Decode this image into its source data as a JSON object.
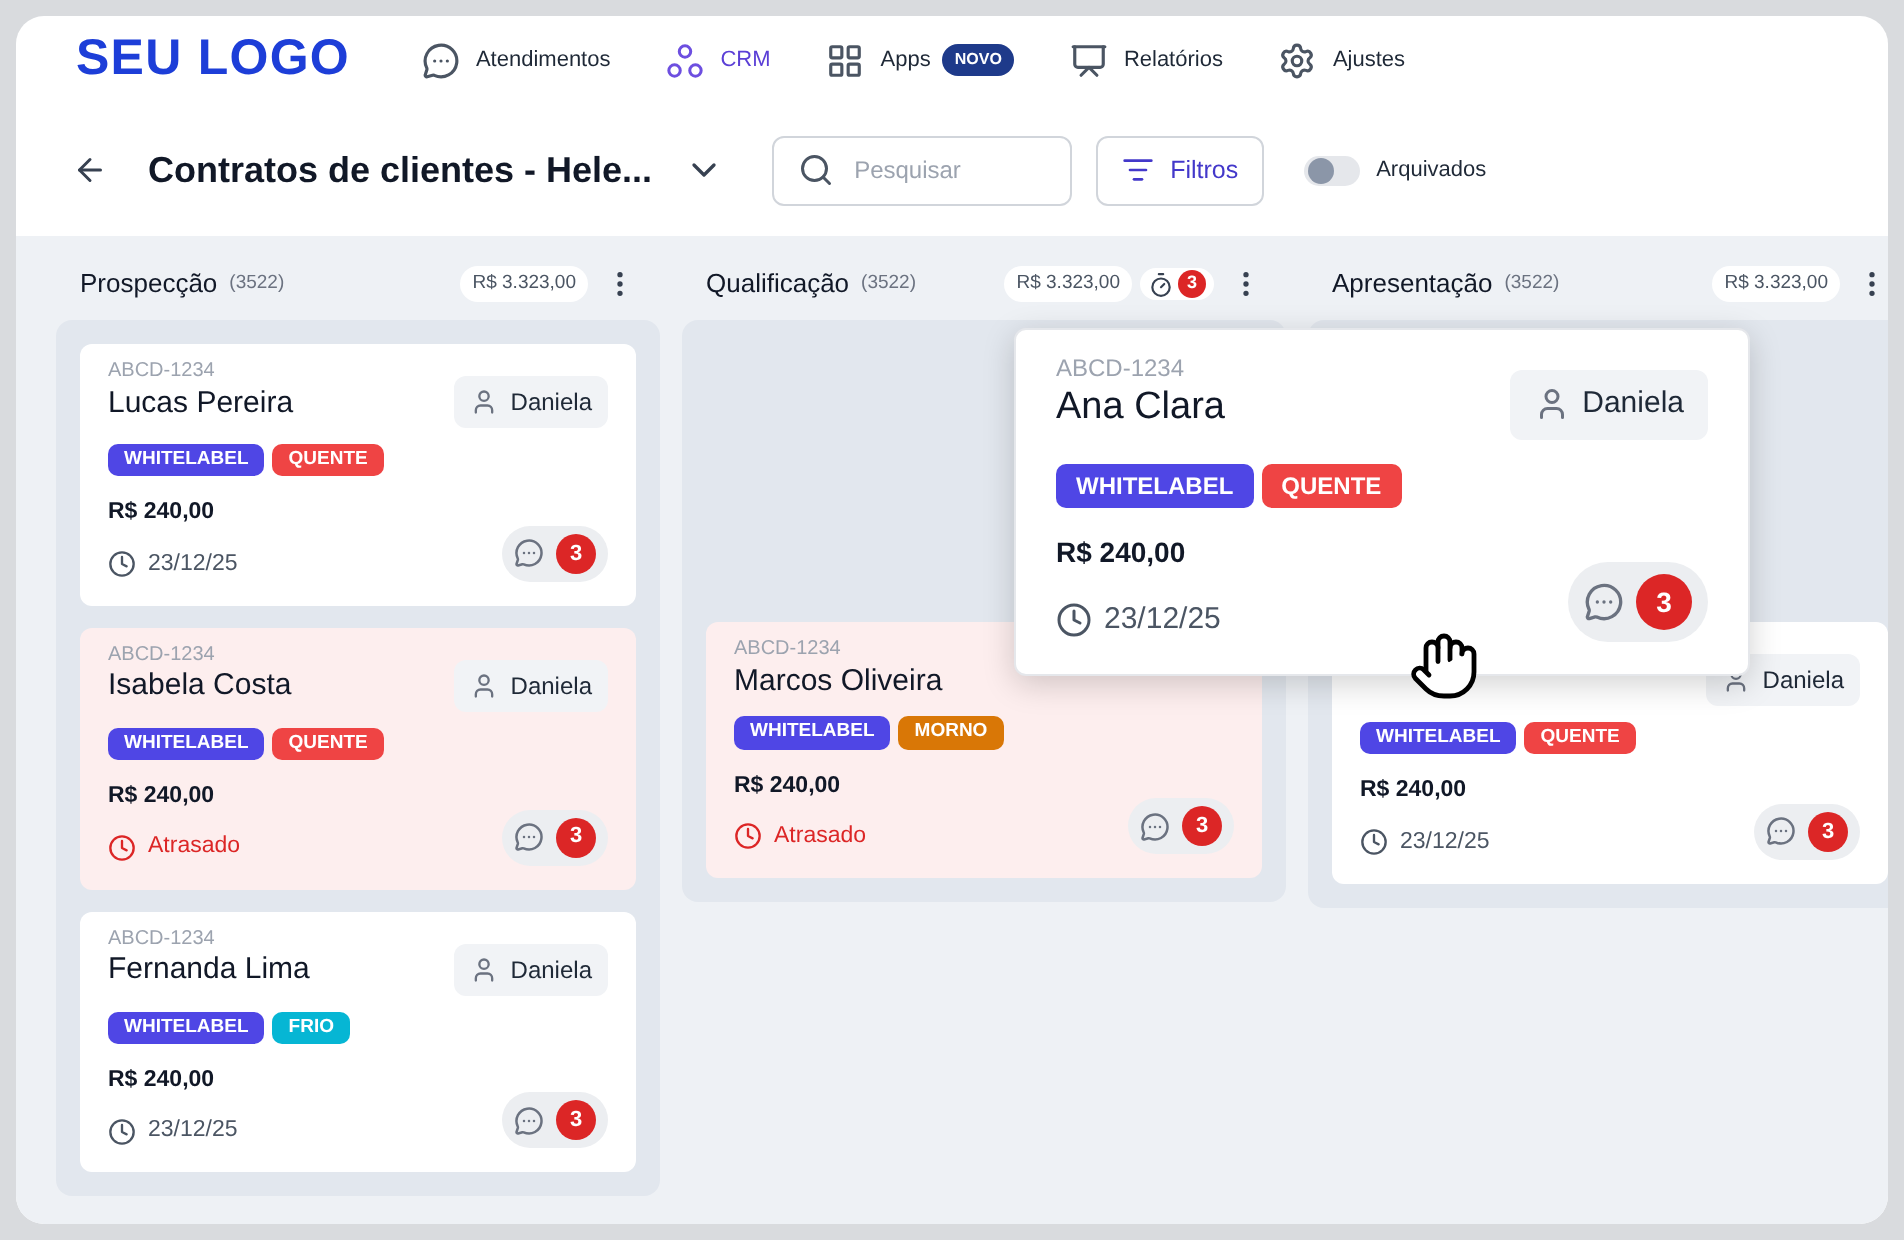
{
  "logo": "SEU LOGO",
  "nav": [
    {
      "kind": "chat",
      "label": "Atendimentos",
      "selected": false
    },
    {
      "kind": "crm",
      "label": "CRM",
      "selected": true
    },
    {
      "kind": "apps",
      "label": "Apps",
      "selected": false,
      "badge": "NOVO"
    },
    {
      "kind": "reports",
      "label": "Relatórios",
      "selected": false
    },
    {
      "kind": "settings",
      "label": "Ajustes",
      "selected": false
    }
  ],
  "toolbar": {
    "title": "Contratos de clientes - Hele...",
    "search": {
      "placeholder": "Pesquisar"
    },
    "filter": "Filtros",
    "archived": {
      "label": "Arquivados",
      "on": false
    }
  },
  "columns": [
    {
      "title": "Prospecção",
      "count": "(3522)",
      "total": "R$ 3.323,00",
      "cards": [
        {
          "kind": "card",
          "id": "ABCD-1234",
          "name": "Lucas Pereira",
          "assignee": "Daniela",
          "tags": [
            {
              "label": "WHITELABEL",
              "color": "#4f46e5"
            },
            {
              "label": "QUENTE",
              "color": "#ef4444"
            }
          ],
          "value": "R$ 240,00",
          "due": "23/12/25",
          "overdue": false,
          "comments": "3"
        },
        {
          "kind": "card",
          "id": "ABCD-1234",
          "name": "Isabela Costa",
          "assignee": "Daniela",
          "tags": [
            {
              "label": "WHITELABEL",
              "color": "#4f46e5"
            },
            {
              "label": "QUENTE",
              "color": "#ef4444"
            }
          ],
          "value": "R$ 240,00",
          "due": "Atrasado",
          "overdue": true,
          "comments": "3"
        },
        {
          "kind": "card",
          "id": "ABCD-1234",
          "name": "Fernanda Lima",
          "assignee": "Daniela",
          "tags": [
            {
              "label": "WHITELABEL",
              "color": "#4f46e5"
            },
            {
              "label": "FRIO",
              "color": "#06b6d4"
            }
          ],
          "value": "R$ 240,00",
          "due": "23/12/25",
          "overdue": false,
          "comments": "3"
        }
      ]
    },
    {
      "title": "Qualificação",
      "count": "(3522)",
      "total": "R$ 3.323,00",
      "alerts": "3",
      "cards": [
        {
          "kind": "placeholder"
        },
        {
          "kind": "card",
          "id": "ABCD-1234",
          "name": "Marcos Oliveira",
          "tags": [
            {
              "label": "WHITELABEL",
              "color": "#4f46e5"
            },
            {
              "label": "MORNO",
              "color": "#d97706"
            }
          ],
          "value": "R$ 240,00",
          "due": "Atrasado",
          "overdue": true,
          "comments": "3"
        }
      ]
    },
    {
      "title": "Apresentação",
      "count": "(3522)",
      "total": "R$ 3.323,00",
      "cards": [
        {
          "kind": "placeholder"
        },
        {
          "kind": "card",
          "assignee": "Daniela",
          "tags": [
            {
              "label": "WHITELABEL",
              "color": "#4f46e5"
            },
            {
              "label": "QUENTE",
              "color": "#ef4444"
            }
          ],
          "value": "R$ 240,00",
          "due": "23/12/25",
          "overdue": false,
          "comments": "3"
        }
      ]
    }
  ],
  "dragged_card": {
    "id": "ABCD-1234",
    "name": "Ana Clara",
    "assignee": "Daniela",
    "tags": [
      {
        "label": "WHITELABEL",
        "color": "#4f46e5"
      },
      {
        "label": "QUENTE",
        "color": "#ef4444"
      }
    ],
    "value": "R$ 240,00",
    "due": "23/12/25",
    "overdue": false,
    "comments": "3"
  }
}
